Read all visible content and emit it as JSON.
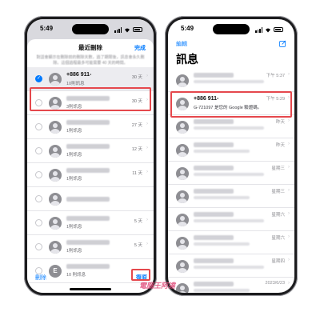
{
  "status_bar": {
    "time": "5:49"
  },
  "left_screen": {
    "title": "最近刪除",
    "done_label": "完成",
    "note": "對話會顯示在刪除前的刪除天數，過了期限後，訊息會永久刪除。這個過程最多可能需要 40 天的時間。",
    "rows": [
      {
        "name": "+886 911-",
        "sub": "10則訊息",
        "days": "30 天",
        "selected": true
      },
      {
        "sub": "3則訊息",
        "days": "30 天"
      },
      {
        "sub": "1則訊息",
        "days": "27 天"
      },
      {
        "sub": "1則訊息",
        "days": "12 天"
      },
      {
        "sub": "1則訊息",
        "days": "11 天"
      },
      {
        "sub": "",
        "days": ""
      },
      {
        "sub": "1則訊息",
        "days": "5 天"
      },
      {
        "sub": "1則訊息",
        "days": "5 天"
      },
      {
        "sub": "10 則訊息",
        "days": "",
        "letter": "E"
      }
    ],
    "delete_label": "刪除",
    "recover_label": "復原"
  },
  "right_screen": {
    "edit_label": "編輯",
    "title": "訊息",
    "rows": [
      {
        "time": "下午 5:37"
      },
      {
        "name": "+886 911-",
        "time": "下午 5:29",
        "preview": "G-721097 是您的 Google 驗證碼。",
        "highlighted": true
      },
      {
        "time": "昨天"
      },
      {
        "time": "昨天"
      },
      {
        "time": "星期三"
      },
      {
        "time": "星期三"
      },
      {
        "time": "星期六"
      },
      {
        "time": "星期六"
      },
      {
        "time": "星期四"
      },
      {
        "time": "2023/6/23"
      }
    ]
  },
  "watermark": "電腦王阿達",
  "colors": {
    "accent": "#007aff",
    "highlight": "#e5484d"
  }
}
